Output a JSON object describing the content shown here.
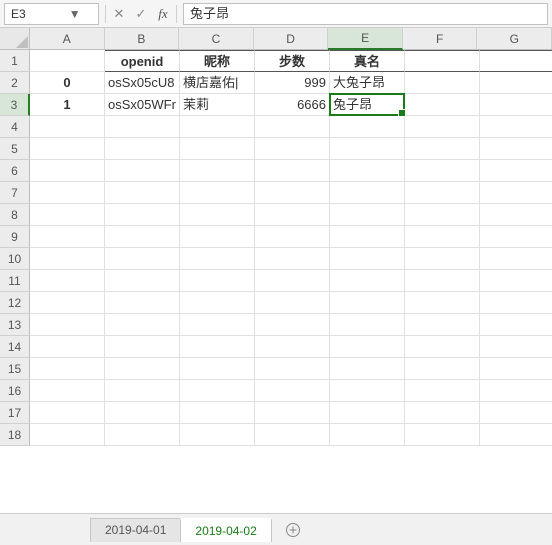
{
  "name_box": {
    "ref": "E3"
  },
  "formula_bar": {
    "value": "兔子昂"
  },
  "columns": [
    "A",
    "B",
    "C",
    "D",
    "E",
    "F",
    "G"
  ],
  "active_col_index": 4,
  "row_numbers": [
    1,
    2,
    3,
    4,
    5,
    6,
    7,
    8,
    9,
    10,
    11,
    12,
    13,
    14,
    15,
    16,
    17,
    18
  ],
  "active_row_index": 2,
  "headers": {
    "b": "openid",
    "c": "昵称",
    "d": "步数",
    "e": "真名"
  },
  "data_rows": [
    {
      "a": "0",
      "b": "osSx05cU8",
      "c": "横店嘉佑|",
      "d": "999",
      "e": "大兔子昂"
    },
    {
      "a": "1",
      "b": "osSx05WFr",
      "c": "茉莉",
      "d": "6666",
      "e": "兔子昂"
    }
  ],
  "sheets": {
    "tabs": [
      "2019-04-01",
      "2019-04-02"
    ],
    "active_index": 1
  },
  "icons": {
    "cancel": "✕",
    "confirm": "✓"
  }
}
